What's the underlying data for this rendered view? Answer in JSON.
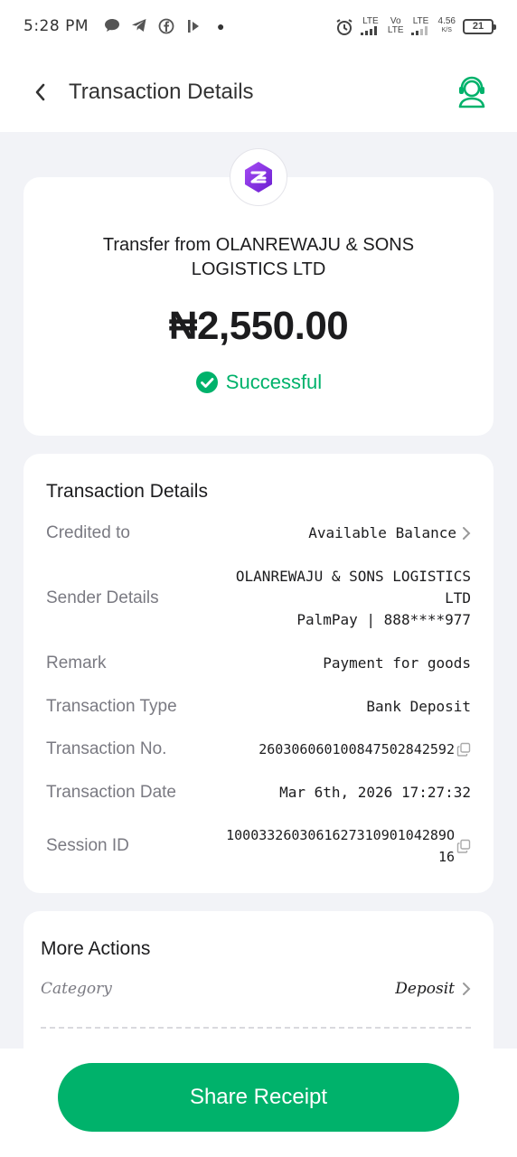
{
  "status_bar": {
    "time": "5:28 PM",
    "net1": "LTE",
    "net2_top": "Vo",
    "net2_bottom": "LTE",
    "net3": "LTE",
    "speed_top": "4.56",
    "speed_bottom": "K/S",
    "battery": "21"
  },
  "header": {
    "title": "Transaction Details",
    "back_icon": "chevron-left-icon",
    "support_icon": "headset-icon"
  },
  "summary": {
    "title": "Transfer from OLANREWAJU & SONS LOGISTICS LTD",
    "amount": "₦2,550.00",
    "status": "Successful",
    "status_color": "#00b26b"
  },
  "details": {
    "heading": "Transaction Details",
    "credited_to": {
      "label": "Credited to",
      "value": "Available Balance"
    },
    "sender": {
      "label": "Sender Details",
      "name_line1": "OLANREWAJU & SONS LOGISTICS",
      "name_line2": "LTD",
      "account": "PalmPay | 888****977"
    },
    "remark": {
      "label": "Remark",
      "value": "Payment for goods"
    },
    "type": {
      "label": "Transaction Type",
      "value": "Bank Deposit"
    },
    "number": {
      "label": "Transaction No.",
      "value": "260306060100847502842592"
    },
    "date": {
      "label": "Transaction Date",
      "value": "Mar 6th, 2026 17:27:32"
    },
    "session": {
      "label": "Session ID",
      "line1": "100033260306162731090104289O",
      "line2": "16"
    }
  },
  "actions": {
    "heading": "More Actions",
    "category_label": "Category",
    "category_value": "Deposit"
  },
  "footer": {
    "share_label": "Share Receipt",
    "accent": "#00b26b"
  }
}
